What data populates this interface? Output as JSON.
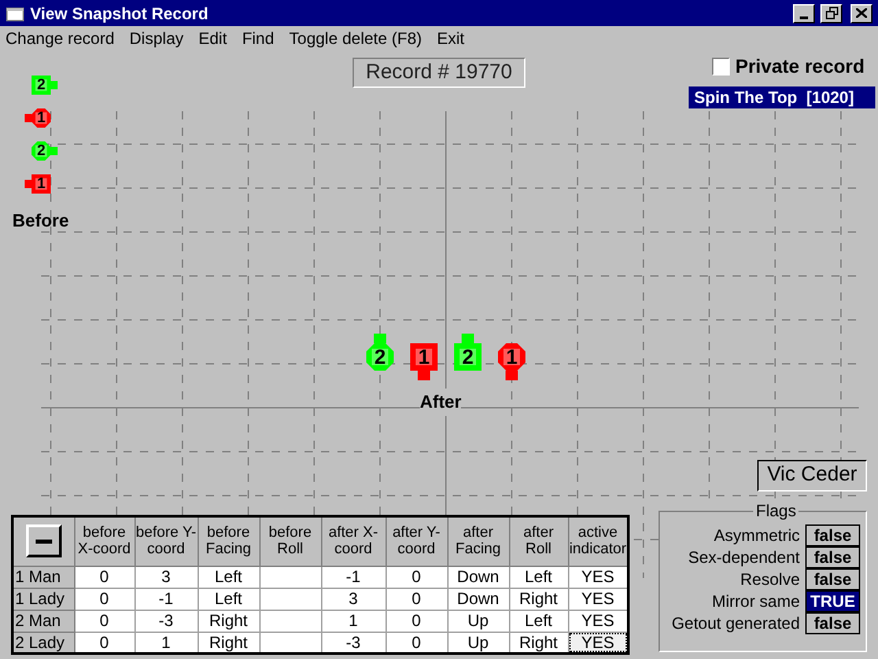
{
  "window": {
    "title": "View Snapshot Record"
  },
  "menu": [
    "Change record",
    "Display",
    "Edit",
    "Find",
    "Toggle delete (F8)",
    "Exit"
  ],
  "record_label": "Record # 19770",
  "private_record": {
    "label": "Private record",
    "checked": false
  },
  "call_name": "Spin The Top  [1020]",
  "before_label": "Before",
  "after_label": "After",
  "before_figures": [
    {
      "number": "2",
      "kind": "man-right",
      "color": "#00ff00"
    },
    {
      "number": "1",
      "kind": "lady-left",
      "color": "#ff0000"
    },
    {
      "number": "2",
      "kind": "lady-right",
      "color": "#00ff00"
    },
    {
      "number": "1",
      "kind": "man-left",
      "color": "#ff0000"
    }
  ],
  "after_figures": [
    {
      "number": "2",
      "kind": "lady-up",
      "color": "#00ff00"
    },
    {
      "number": "1",
      "kind": "man-down",
      "color": "#ff0000"
    },
    {
      "number": "2",
      "kind": "man-up",
      "color": "#00ff00"
    },
    {
      "number": "1",
      "kind": "lady-down",
      "color": "#ff0000"
    }
  ],
  "author": "Vic Ceder",
  "table": {
    "columns": [
      "before X-coord",
      "before Y-coord",
      "before Facing",
      "before Roll",
      "after X-coord",
      "after Y-coord",
      "after Facing",
      "after Roll",
      "active indicator"
    ],
    "rows": [
      {
        "dancer": "1 Man",
        "cells": [
          "0",
          "3",
          "Left",
          "",
          "-1",
          "0",
          "Down",
          "Left",
          "YES"
        ],
        "focused": false
      },
      {
        "dancer": "1 Lady",
        "cells": [
          "0",
          "-1",
          "Left",
          "",
          "3",
          "0",
          "Down",
          "Right",
          "YES"
        ],
        "focused": false
      },
      {
        "dancer": "2 Man",
        "cells": [
          "0",
          "-3",
          "Right",
          "",
          "1",
          "0",
          "Up",
          "Left",
          "YES"
        ],
        "focused": false
      },
      {
        "dancer": "2 Lady",
        "cells": [
          "0",
          "1",
          "Right",
          "",
          "-3",
          "0",
          "Up",
          "Right",
          "YES"
        ],
        "focused": true
      }
    ]
  },
  "flags": {
    "title": "Flags",
    "items": [
      {
        "label": "Asymmetric",
        "value": "false",
        "on": false
      },
      {
        "label": "Sex-dependent",
        "value": "false",
        "on": false
      },
      {
        "label": "Resolve",
        "value": "false",
        "on": false
      },
      {
        "label": "Mirror same",
        "value": "TRUE",
        "on": true
      },
      {
        "label": "Getout generated",
        "value": "false",
        "on": false
      }
    ]
  }
}
